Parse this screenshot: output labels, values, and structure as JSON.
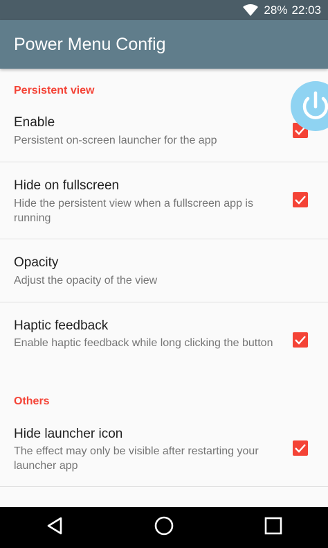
{
  "status_bar": {
    "battery": "28%",
    "time": "22:03",
    "icons": [
      "wifi-icon"
    ]
  },
  "app_bar": {
    "title": "Power Menu Config"
  },
  "colors": {
    "status_bar": "#4b5d67",
    "app_bar": "#607d8b",
    "accent": "#f44336",
    "floating_button": "#8fd3f2"
  },
  "categories": {
    "persistent_view": "Persistent view",
    "others": "Others"
  },
  "prefs": {
    "enable": {
      "title": "Enable",
      "summary": "Persistent on-screen launcher for the app",
      "checked": true
    },
    "hide_fullscreen": {
      "title": "Hide on fullscreen",
      "summary": "Hide the persistent view when a fullscreen app is running",
      "checked": true
    },
    "opacity": {
      "title": "Opacity",
      "summary": "Adjust the opacity of the view"
    },
    "haptic": {
      "title": "Haptic feedback",
      "summary": "Enable haptic feedback while long clicking the button",
      "checked": true
    },
    "hide_launcher": {
      "title": "Hide launcher icon",
      "summary": "The effect may only be visible after restarting your launcher app",
      "checked": true
    }
  },
  "floating_button": {
    "icon": "power-icon"
  },
  "nav_bar": {
    "icons": [
      "back-icon",
      "home-icon",
      "recents-icon"
    ]
  }
}
